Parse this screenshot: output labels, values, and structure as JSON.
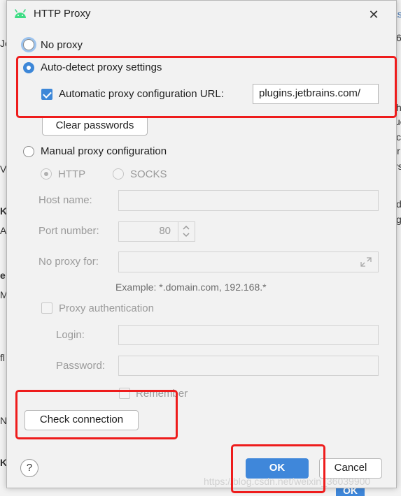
{
  "window": {
    "title": "HTTP Proxy"
  },
  "background_fragments": [
    "as",
    "6",
    "Je",
    "h",
    "uc",
    "c",
    "ir",
    "V",
    "rs",
    "d",
    "K",
    "A",
    "g",
    "e",
    "M",
    "fl",
    "N",
    "K",
    "OK"
  ],
  "proxy": {
    "no_proxy_label": "No proxy",
    "auto_detect_label": "Auto-detect proxy settings",
    "auto_config_url_label": "Automatic proxy configuration URL:",
    "auto_config_url_value": "plugins.jetbrains.com/",
    "auto_config_url_checked": true,
    "clear_passwords_label": "Clear passwords",
    "manual_label": "Manual proxy configuration",
    "selected": "auto_detect"
  },
  "manual": {
    "http_label": "HTTP",
    "socks_label": "SOCKS",
    "host_name_label": "Host name:",
    "host_name_value": "",
    "port_number_label": "Port number:",
    "port_number_value": "80",
    "no_proxy_for_label": "No proxy for:",
    "no_proxy_for_value": "",
    "example_hint": "Example: *.domain.com, 192.168.*",
    "auth_label": "Proxy authentication",
    "login_label": "Login:",
    "login_value": "",
    "password_label": "Password:",
    "password_value": "",
    "remember_label": "Remember"
  },
  "footer": {
    "check_connection_label": "Check connection",
    "help_label": "?",
    "ok_label": "OK",
    "cancel_label": "Cancel"
  },
  "watermark": "https://blog.csdn.net/weixin_36039900",
  "highlight_color": "#ee1c1c",
  "accent_color": "#3f87da"
}
